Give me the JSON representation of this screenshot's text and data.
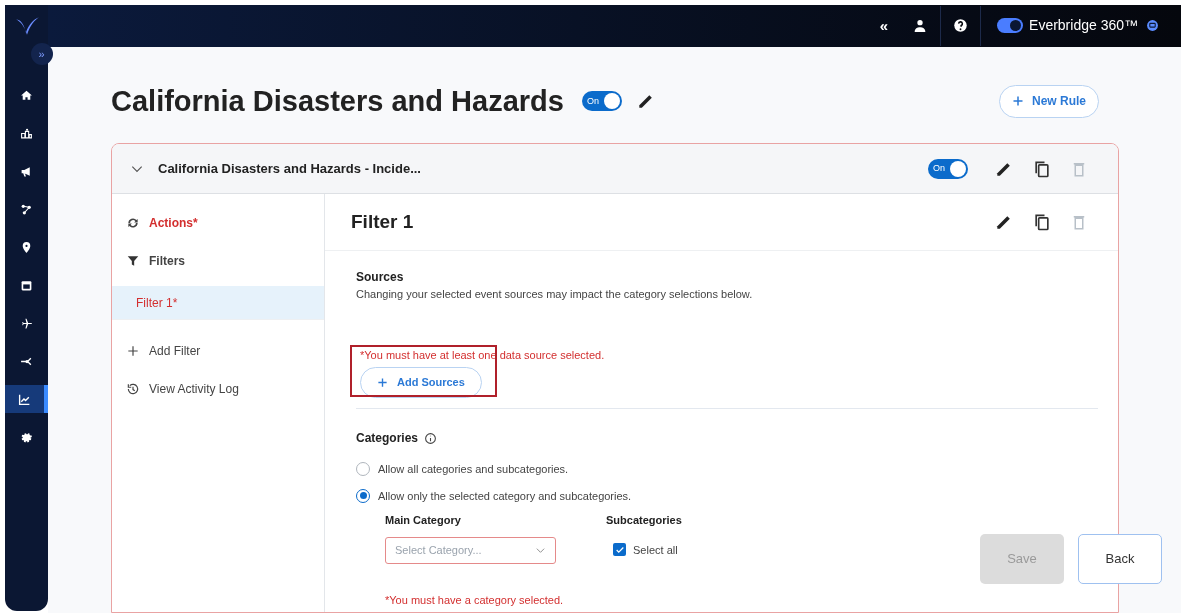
{
  "nav": {
    "expand": "»",
    "items": [
      {
        "kind": "home",
        "selected": false
      },
      {
        "kind": "people",
        "selected": false
      },
      {
        "kind": "megaphone",
        "selected": false
      },
      {
        "kind": "nodes",
        "selected": false
      },
      {
        "kind": "pin",
        "selected": false
      },
      {
        "kind": "calendar",
        "selected": false
      },
      {
        "kind": "plane",
        "selected": false
      },
      {
        "kind": "network",
        "selected": false
      },
      {
        "kind": "chart",
        "selected": true
      },
      {
        "kind": "gear",
        "selected": false
      }
    ]
  },
  "top_bar": {
    "collapse": "«",
    "product_toggle": {
      "on": true
    },
    "product": "Everbridge 360™"
  },
  "page": {
    "title": "California Disasters and Hazards",
    "toggle": {
      "label": "On",
      "on": true
    },
    "new_rule": "New Rule"
  },
  "rule": {
    "title": "California Disasters and Hazards - Incide...",
    "expanded": true,
    "toggle": {
      "label": "On",
      "on": true
    },
    "sidebar": {
      "items": [
        {
          "kind": "actions",
          "label": "Actions*",
          "error": true,
          "selected": false
        },
        {
          "kind": "filters",
          "label": "Filters",
          "error": false,
          "selected": false
        },
        {
          "kind": "filter",
          "label": "Filter 1*",
          "error": true,
          "selected": true
        },
        {
          "kind": "add",
          "label": "Add Filter",
          "error": false,
          "selected": false
        },
        {
          "kind": "log",
          "label": "View Activity Log",
          "error": false,
          "selected": false
        }
      ]
    },
    "filter": {
      "title": "Filter 1",
      "sources": {
        "heading": "Sources",
        "description": "Changing your selected event sources may impact the category selections below.",
        "error": "*You must have at least one data source selected.",
        "add_button": "Add Sources"
      },
      "categories": {
        "heading": "Categories",
        "options": [
          {
            "label": "Allow all categories and subcategories.",
            "selected": false
          },
          {
            "label": "Allow only the selected category and subcategories.",
            "selected": true
          }
        ],
        "main_category": {
          "label": "Main Category",
          "placeholder": "Select Category..."
        },
        "subcategories": {
          "label": "Subcategories",
          "select_all": {
            "label": "Select all",
            "checked": true
          }
        },
        "error": "*You must have a category selected."
      }
    }
  },
  "buttons": [
    {
      "label": "Save",
      "disabled": true
    },
    {
      "label": "Back",
      "disabled": false
    }
  ]
}
